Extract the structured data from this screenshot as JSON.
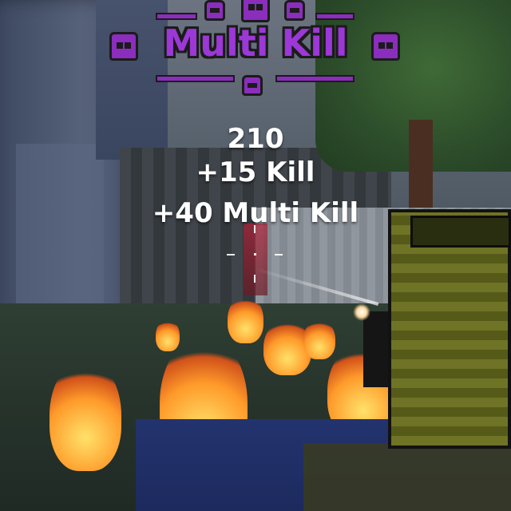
{
  "hud": {
    "banner_title": "Multi Kill",
    "banner_color": "#9b38d6",
    "banner_icons": [
      "skull-icon",
      "skull-icon",
      "skull-icon",
      "skull-icon",
      "skull-icon",
      "skull-icon"
    ],
    "score_total": "210",
    "score_kill": "+15 Kill",
    "score_multi_kill": "+40 Multi Kill"
  },
  "crosshair": {
    "icon": "crosshair-icon"
  },
  "weapon": {
    "icon": "pixel-rifle-icon",
    "color": "#6f7325"
  }
}
